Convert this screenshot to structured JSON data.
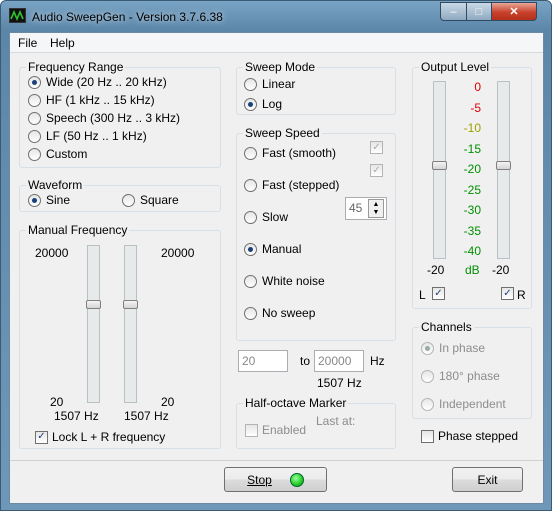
{
  "window": {
    "title": "Audio SweepGen - Version 3.7.6.38",
    "minimize": "–",
    "maximize": "□",
    "close": "✕"
  },
  "menu": {
    "file": "File",
    "help": "Help"
  },
  "frequency_range": {
    "title": "Frequency Range",
    "options": [
      "Wide  (20 Hz .. 20 kHz)",
      "HF  (1 kHz .. 15 kHz)",
      "Speech  (300 Hz .. 3 kHz)",
      "LF  (50 Hz .. 1 kHz)",
      "Custom"
    ],
    "selected": 0
  },
  "waveform": {
    "title": "Waveform",
    "sine": "Sine",
    "square": "Square",
    "selected": "sine"
  },
  "manual_frequency": {
    "title": "Manual Frequency",
    "left_max": "20000",
    "right_max": "20000",
    "left_min": "20",
    "right_min": "20",
    "left_value": "1507 Hz",
    "right_value": "1507 Hz",
    "lock_label": "Lock L + R frequency",
    "lock_checked": true
  },
  "sweep_mode": {
    "title": "Sweep Mode",
    "linear": "Linear",
    "log": "Log",
    "selected": "log"
  },
  "sweep_speed": {
    "title": "Sweep Speed",
    "options": [
      "Fast (smooth)",
      "Fast (stepped)",
      "Slow",
      "Manual",
      "White noise",
      "No sweep"
    ],
    "selected": 3,
    "spin_value": "45"
  },
  "range": {
    "from": "20",
    "to_label": "to",
    "to": "20000",
    "unit": "Hz",
    "current": "1507 Hz"
  },
  "half_octave": {
    "title": "Half-octave Marker",
    "enabled_label": "Enabled",
    "last_at_label": "Last at:"
  },
  "output_level": {
    "title": "Output Level",
    "scale": [
      "0",
      "-5",
      "-10",
      "-15",
      "-20",
      "-25",
      "-30",
      "-35",
      "-40"
    ],
    "scale_colors": [
      "#e00000",
      "#e00000",
      "#a0a000",
      "#009000",
      "#009000",
      "#009000",
      "#009000",
      "#009000",
      "#009000"
    ],
    "left_value": "-20",
    "right_value": "-20",
    "unit": "dB",
    "left_label": "L",
    "right_label": "R",
    "left_checked": true,
    "right_checked": true
  },
  "channels": {
    "title": "Channels",
    "options": [
      "In phase",
      "180° phase",
      "Independent"
    ],
    "selected": 0
  },
  "phase_stepped": {
    "label": "Phase stepped",
    "checked": false
  },
  "buttons": {
    "stop": "Stop",
    "exit": "Exit"
  },
  "colors": {
    "indicator": "#22cc22",
    "accent": "#1a3f7a"
  }
}
